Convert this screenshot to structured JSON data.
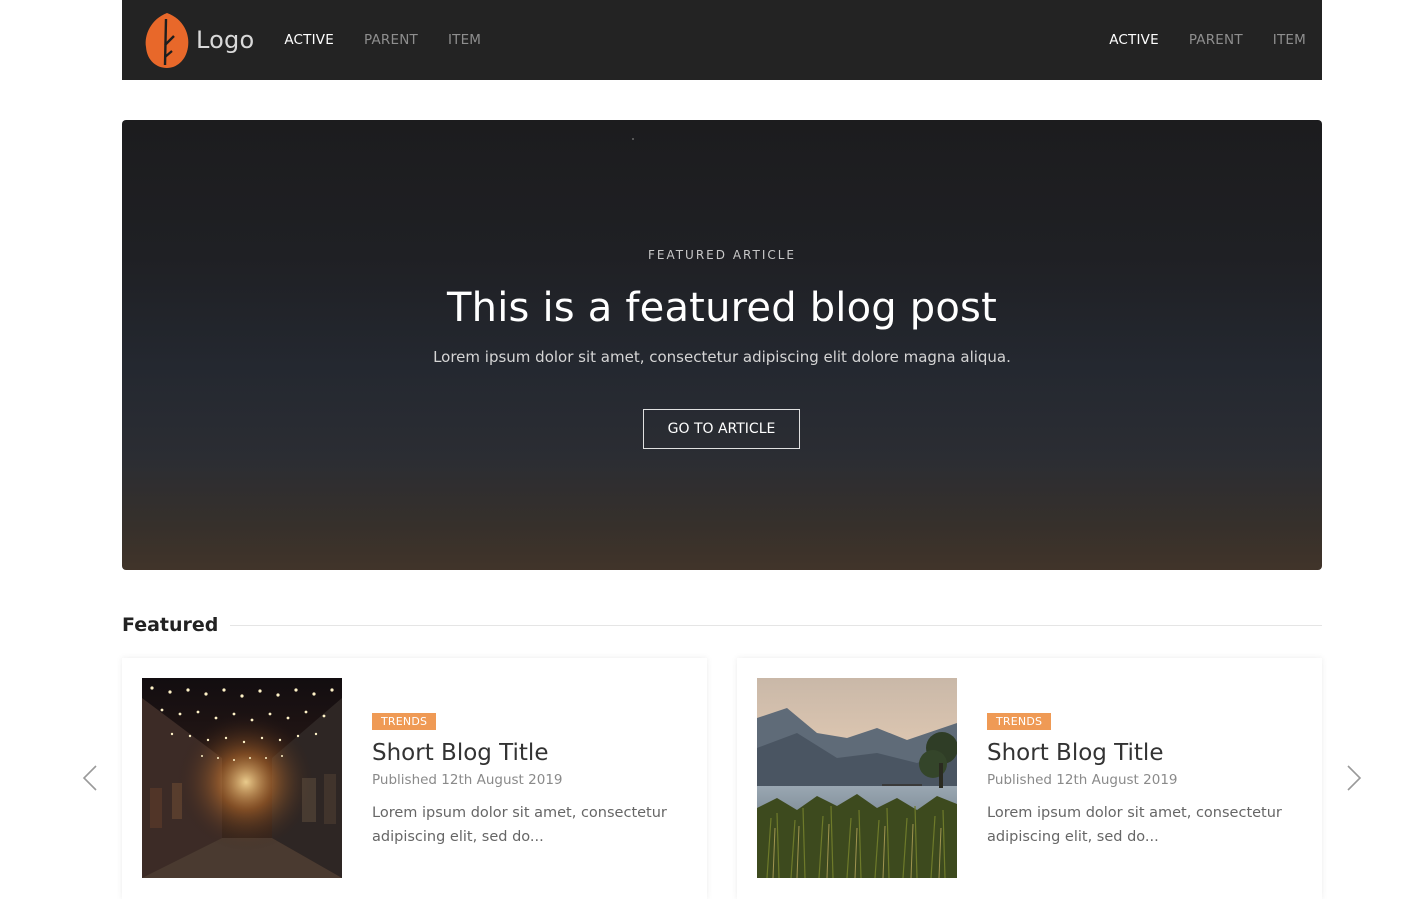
{
  "navbar": {
    "brand": "Logo",
    "left_links": [
      {
        "label": "ACTIVE"
      },
      {
        "label": "PARENT"
      },
      {
        "label": "ITEM"
      }
    ],
    "right_links": [
      {
        "label": "ACTIVE"
      },
      {
        "label": "PARENT"
      },
      {
        "label": "ITEM"
      }
    ],
    "logo_color": "#e8682a"
  },
  "hero": {
    "eyebrow": "FEATURED ARTICLE",
    "title": "This is a featured blog post",
    "text": "Lorem ipsum dolor sit amet, consectetur adipiscing elit dolore magna aliqua.",
    "button": "GO TO ARTICLE"
  },
  "featured": {
    "heading": "Featured",
    "cards": [
      {
        "tag": "TRENDS",
        "title": "Short Blog Title",
        "date": "Published 12th August 2019",
        "text": "Lorem ipsum dolor sit amet, consectetur adipiscing elit, sed do..."
      },
      {
        "tag": "TRENDS",
        "title": "Short Blog Title",
        "date": "Published 12th August 2019",
        "text": "Lorem ipsum dolor sit amet, consectetur adipiscing elit, sed do..."
      }
    ]
  },
  "carousel": {
    "prev_icon": "chevron-left-icon",
    "next_icon": "chevron-right-icon"
  },
  "colors": {
    "navbar_bg": "#232323",
    "accent_badge": "#ef9a55",
    "active_link": "#ffffff",
    "inactive_link": "#8e8e8e"
  }
}
